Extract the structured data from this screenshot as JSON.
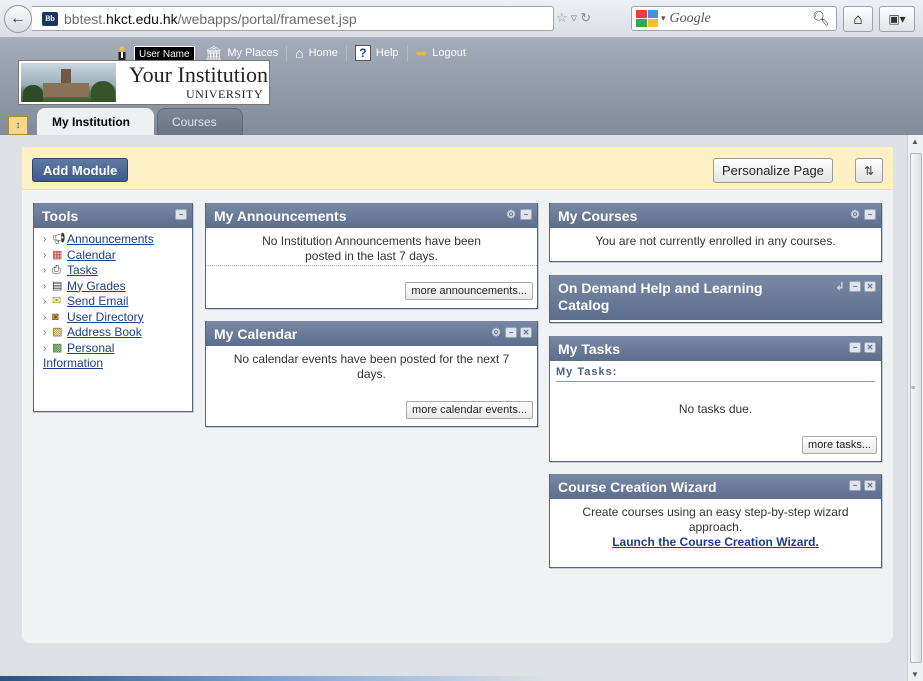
{
  "browser": {
    "url_host_prefix": "bbtest.",
    "url_host": "hkct.edu.hk",
    "url_path": "/webapps/portal/frameset.jsp",
    "site_icon_text": "Bb",
    "search_placeholder": "Google"
  },
  "header": {
    "logo_line1": "Your Institution",
    "logo_line2": "UNIVERSITY",
    "user_name": "User Name",
    "nav": {
      "my_places": "My Places",
      "home": "Home",
      "help": "Help",
      "logout": "Logout"
    },
    "tabs": [
      {
        "label": "My Institution",
        "active": true
      },
      {
        "label": "Courses",
        "active": false
      }
    ]
  },
  "toolbar": {
    "add_module": "Add Module",
    "personalize": "Personalize Page"
  },
  "modules": {
    "tools": {
      "title": "Tools",
      "items": [
        {
          "label": "Announcements",
          "icon": "announcements-icon"
        },
        {
          "label": "Calendar",
          "icon": "calendar-icon"
        },
        {
          "label": "Tasks",
          "icon": "tasks-icon"
        },
        {
          "label": "My Grades",
          "icon": "grades-icon"
        },
        {
          "label": "Send Email",
          "icon": "email-icon"
        },
        {
          "label": "User Directory",
          "icon": "directory-icon"
        },
        {
          "label": "Address Book",
          "icon": "address-book-icon"
        },
        {
          "label": "Personal",
          "label2": "Information",
          "icon": "personal-info-icon"
        }
      ]
    },
    "announcements": {
      "title": "My Announcements",
      "message": "No Institution Announcements have been posted in the last 7 days.",
      "more": "more announcements..."
    },
    "calendar": {
      "title": "My Calendar",
      "message": "No calendar events have been posted for the next 7 days.",
      "more": "more calendar events..."
    },
    "courses": {
      "title": "My Courses",
      "message": "You are not currently enrolled in any courses."
    },
    "on_demand": {
      "title": "On Demand Help and Learning Catalog"
    },
    "tasks": {
      "title": "My Tasks",
      "subtitle": "My Tasks:",
      "message": "No tasks due.",
      "more": "more tasks..."
    },
    "wizard": {
      "title": "Course Creation Wizard",
      "message": "Create courses using an easy step-by-step wizard approach.",
      "link": "Launch the Course Creation Wizard."
    }
  },
  "colors": {
    "header_bg": "#8f98a6",
    "module_head": "#5c6e8d",
    "module_bar": "#fdf0c4",
    "link": "#1c3d8c"
  }
}
